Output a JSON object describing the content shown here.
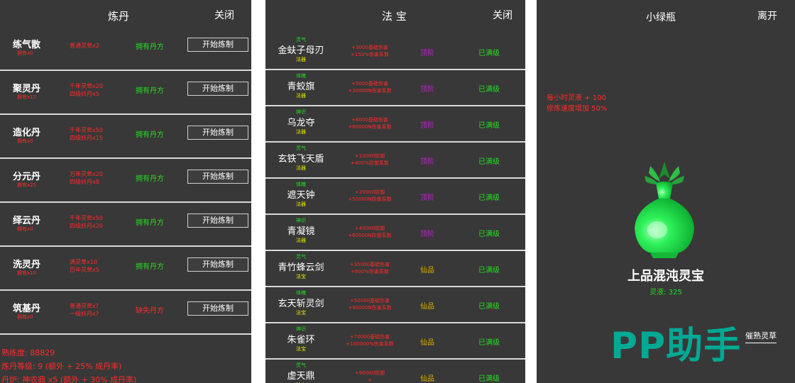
{
  "alchemy": {
    "title": "炼丹",
    "close": "关闭",
    "recipes": [
      {
        "name": "练气散",
        "owned": "拥有x0",
        "materials": [
          "普通灵草x2"
        ],
        "status": "拥有丹方",
        "status_color": "#22dd22",
        "button": "开始炼制"
      },
      {
        "name": "聚灵丹",
        "owned": "拥有x12",
        "materials": [
          "千年灵草x20",
          "四级妖丹x5"
        ],
        "status": "拥有丹方",
        "status_color": "#22dd22",
        "button": "开始炼制"
      },
      {
        "name": "造化丹",
        "owned": "拥有x0",
        "materials": [
          "千年灵草x50",
          "四级妖丹x15"
        ],
        "status": "拥有丹方",
        "status_color": "#22dd22",
        "button": "开始炼制"
      },
      {
        "name": "分元丹",
        "owned": "拥有x25",
        "materials": [
          "万年灵草x20",
          "四级妖丹x8"
        ],
        "status": "拥有丹方",
        "status_color": "#22dd22",
        "button": "开始炼制"
      },
      {
        "name": "绎云丹",
        "owned": "拥有x0",
        "materials": [
          "千年灵草x50",
          "四级妖丹x20"
        ],
        "status": "拥有丹方",
        "status_color": "#22dd22",
        "button": "开始炼制"
      },
      {
        "name": "洗灵丹",
        "owned": "拥有x10",
        "materials": [
          "满灵草x10",
          "百年灵草x5"
        ],
        "status": "拥有丹方",
        "status_color": "#22dd22",
        "button": "开始炼制"
      },
      {
        "name": "筑基丹",
        "owned": "拥有x0",
        "materials": [
          "普通灵草x?",
          "一级妖丹x?"
        ],
        "status": "缺失丹方",
        "status_color": "#ff2a2a",
        "button": "开始炼制"
      }
    ],
    "footer": {
      "proficiency": "熟练度: 88829",
      "level": "炼丹等级: 9 (额外 + 25% 成丹率)",
      "furnace": "丹炉: 神农鼎 x5 (额外 + 30% 成丹率)"
    }
  },
  "treasures": {
    "title": "法 宝",
    "close": "关闭",
    "items": [
      {
        "type": "灵气",
        "name": "金蚨子母刃",
        "category": "法器",
        "effects": [
          "+3000基础伤害",
          "+150%伤害系数"
        ],
        "grade": "顶阶",
        "grade_color": "#c020d0",
        "level": "已满级"
      },
      {
        "type": "体魄",
        "name": "青蛟旗",
        "category": "法器",
        "effects": [
          "+5000基础伤害",
          "+30000N伤害系数"
        ],
        "grade": "顶阶",
        "grade_color": "#c020d0",
        "level": "已满级"
      },
      {
        "type": "神识",
        "name": "乌龙夺",
        "category": "法器",
        "effects": [
          "+8000基础伤害",
          "+60000N伤害系数"
        ],
        "grade": "顶阶",
        "grade_color": "#c020d0",
        "level": "已满级"
      },
      {
        "type": "灵气",
        "name": "玄铁飞天盾",
        "category": "法器",
        "effects": [
          "+10000防御",
          "+400%防御系数"
        ],
        "grade": "顶阶",
        "grade_color": "#c020d0",
        "level": "已满级"
      },
      {
        "type": "体魄",
        "name": "遮天钟",
        "category": "法器",
        "effects": [
          "+20000防御",
          "+50000N防御系数"
        ],
        "grade": "顶阶",
        "grade_color": "#c020d0",
        "level": "已满级"
      },
      {
        "type": "神识",
        "name": "青凝镜",
        "category": "法器",
        "effects": [
          "+40000防御",
          "+60000N防御系数"
        ],
        "grade": "顶阶",
        "grade_color": "#c020d0",
        "level": "已满级"
      },
      {
        "type": "灵气",
        "name": "青竹蜂云剑",
        "category": "法宝",
        "effects": [
          "+35000基础伤害",
          "+800%伤害系数"
        ],
        "grade": "仙品",
        "grade_color": "#e0b000",
        "level": "已满级"
      },
      {
        "type": "体魄",
        "name": "玄天斩灵剑",
        "category": "法宝",
        "effects": [
          "+50000基础伤害",
          "+90000N伤害系数"
        ],
        "grade": "仙品",
        "grade_color": "#e0b000",
        "level": "已满级"
      },
      {
        "type": "神识",
        "name": "朱雀环",
        "category": "法宝",
        "effects": [
          "+70000基础伤害",
          "+100000%伤害系数"
        ],
        "grade": "仙品",
        "grade_color": "#e0b000",
        "level": "已满级"
      },
      {
        "type": "灵气",
        "name": "虚天鼎",
        "category": "法宝",
        "effects": [
          "+90000防御",
          "+"
        ],
        "grade": "仙品",
        "grade_color": "#e0b000",
        "level": "已满级"
      }
    ]
  },
  "bottle": {
    "title": "小绿瓶",
    "leave": "离开",
    "bonus": [
      "每小时灵液 + 100",
      "修炼速度增加 50%"
    ],
    "vase_icon": "green-vase-icon",
    "vase_name": "上品混沌灵宝",
    "liquid": "灵液: 325",
    "herb_button": "催熟灵草",
    "watermark": "PP助手"
  }
}
